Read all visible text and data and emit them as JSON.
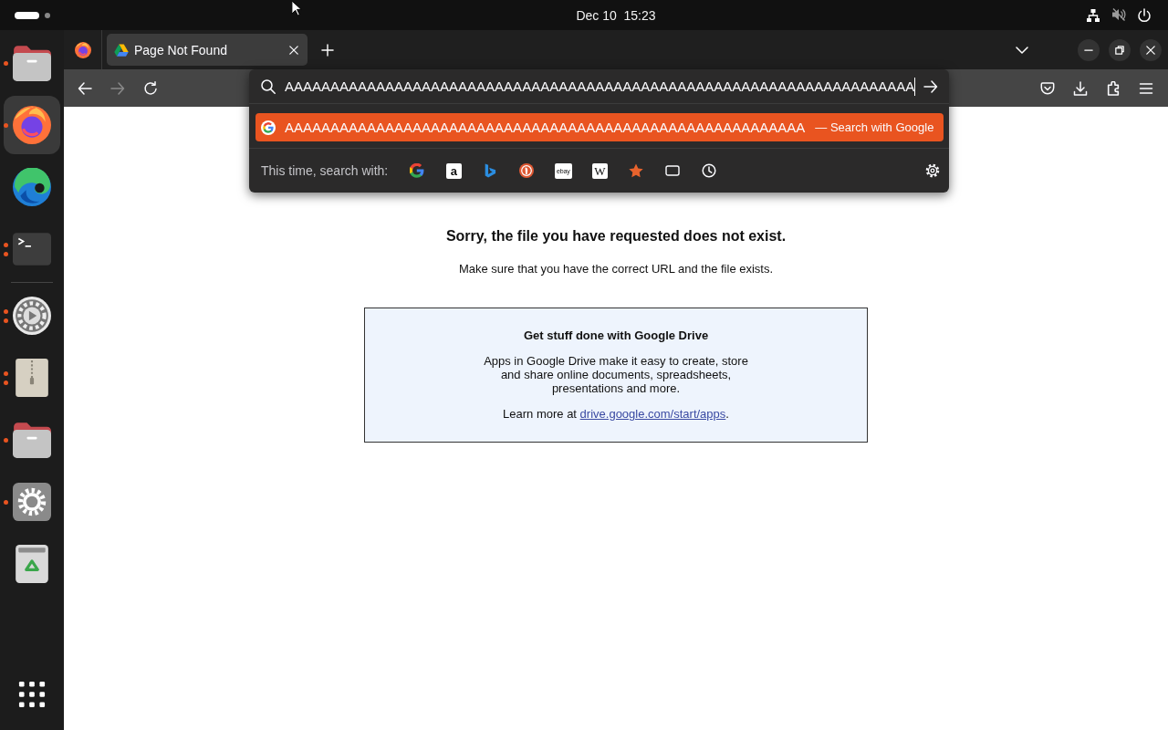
{
  "top_bar": {
    "clock": "Dec 10  15:23"
  },
  "dock": {
    "favorites": [
      {
        "kind": "files",
        "running": true,
        "multiple_windows": false,
        "selected": false
      },
      {
        "kind": "firefox",
        "running": true,
        "multiple_windows": false,
        "selected": true
      },
      {
        "kind": "edge",
        "running": false,
        "multiple_windows": false,
        "selected": false
      },
      {
        "kind": "terminal",
        "running": true,
        "multiple_windows": true,
        "selected": false
      }
    ],
    "others": [
      {
        "kind": "media",
        "running": true,
        "multiple_windows": true,
        "selected": false
      },
      {
        "kind": "archive",
        "running": true,
        "multiple_windows": true,
        "selected": false
      },
      {
        "kind": "files",
        "running": true,
        "multiple_windows": false,
        "selected": false
      },
      {
        "kind": "settings",
        "running": true,
        "multiple_windows": false,
        "selected": false
      },
      {
        "kind": "trash",
        "running": false,
        "multiple_windows": false,
        "selected": false
      }
    ]
  },
  "browser": {
    "tabs": [
      {
        "title": "Page Not Found",
        "selected": true
      }
    ],
    "nav_buttons": [
      {
        "kind": "back",
        "disabled": false
      },
      {
        "kind": "forward",
        "disabled": true
      },
      {
        "kind": "reload",
        "disabled": false
      }
    ],
    "toolbar_buttons": [
      {
        "kind": "pocket"
      },
      {
        "kind": "downloads"
      },
      {
        "kind": "extensions"
      },
      {
        "kind": "menu"
      }
    ],
    "address_panel": {
      "value": "AAAAAAAAAAAAAAAAAAAAAAAAAAAAAAAAAAAAAAAAAAAAAAAAAAAAAAAAAAAAAAAAAAAAA",
      "suggestions": [
        {
          "text": "AAAAAAAAAAAAAAAAAAAAAAAAAAAAAAAAAAAAAAAAAAAAAAAAAAAAAAAAA",
          "separator": "—",
          "action": "Search with Google",
          "selected": true
        }
      ],
      "search_with": {
        "label": "This time, search with:",
        "engines": [
          {
            "kind": "google"
          },
          {
            "kind": "amazon",
            "glyph": "a"
          },
          {
            "kind": "bing"
          },
          {
            "kind": "duckduckgo"
          },
          {
            "kind": "ebay",
            "glyph": "ebay"
          },
          {
            "kind": "wikipedia",
            "glyph": "W"
          },
          {
            "kind": "bookmarks"
          },
          {
            "kind": "tabs"
          },
          {
            "kind": "history"
          }
        ]
      }
    }
  },
  "page": {
    "heading": "Sorry, the file you have requested does not exist.",
    "message": "Make sure that you have the correct URL and the file exists.",
    "promo": {
      "title": "Get stuff done with Google Drive",
      "description": "Apps in Google Drive make it easy to create, store and share online documents, spreadsheets, presentations and more.",
      "learn_more": "Learn more at",
      "link": "drive.google.com/start/apps",
      "link_suffix": "."
    }
  }
}
